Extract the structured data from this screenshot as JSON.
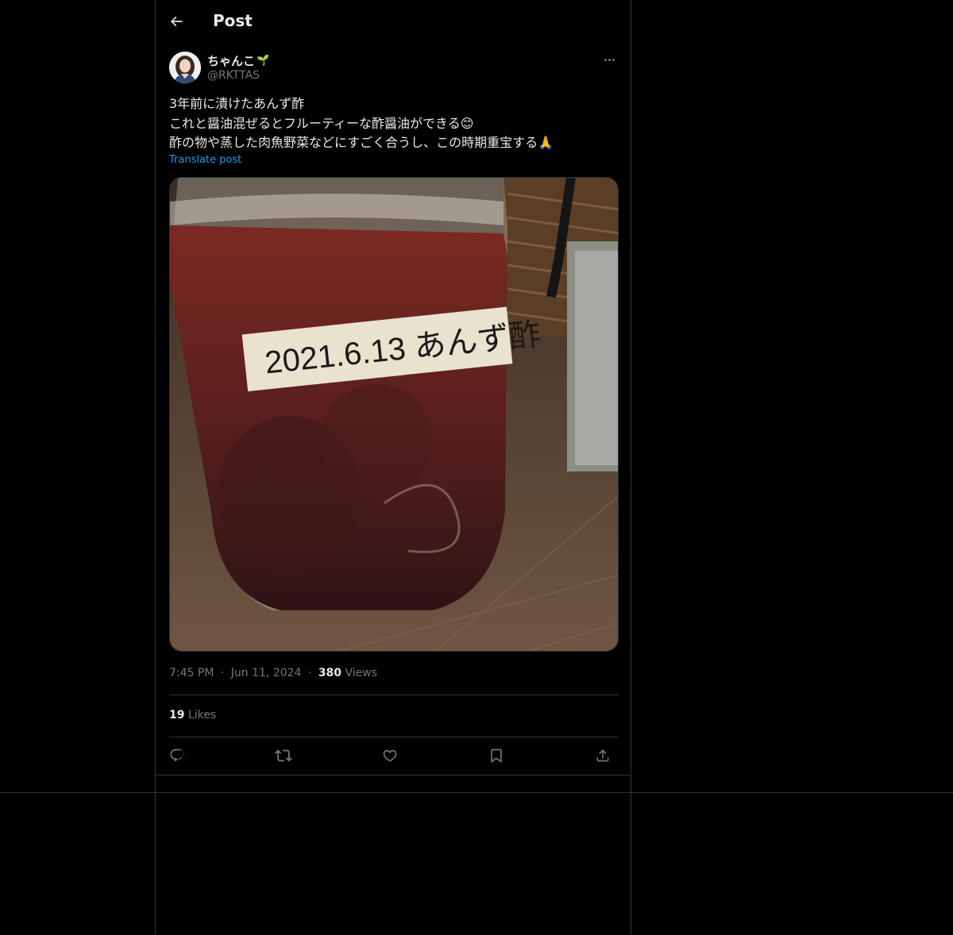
{
  "header": {
    "title": "Post"
  },
  "author": {
    "display_name": "ちゃんこ",
    "name_emoji": "🌱",
    "handle": "@RKTTAS"
  },
  "post": {
    "lines": [
      "3年前に漬けたあんず酢",
      "これと醤油混ぜるとフルーティーな酢醤油ができる😊",
      "酢の物や蒸した肉魚野菜などにすごく合うし、この時期重宝する🙏"
    ],
    "translate_label": "Translate post",
    "image_label_text": "2021.6.13 あんず酢"
  },
  "meta": {
    "time": "7:45 PM",
    "dot": "·",
    "date": "Jun 11, 2024",
    "views_count": "380",
    "views_label": "Views"
  },
  "stats": {
    "likes_count": "19",
    "likes_label": "Likes"
  },
  "actions": [
    "reply-icon",
    "repost-icon",
    "like-icon",
    "bookmark-icon",
    "share-icon"
  ],
  "colors": {
    "background": "#000000",
    "text": "#e7e9ea",
    "muted": "#71767b",
    "accent": "#1d9bf0",
    "border": "#2f3336"
  }
}
